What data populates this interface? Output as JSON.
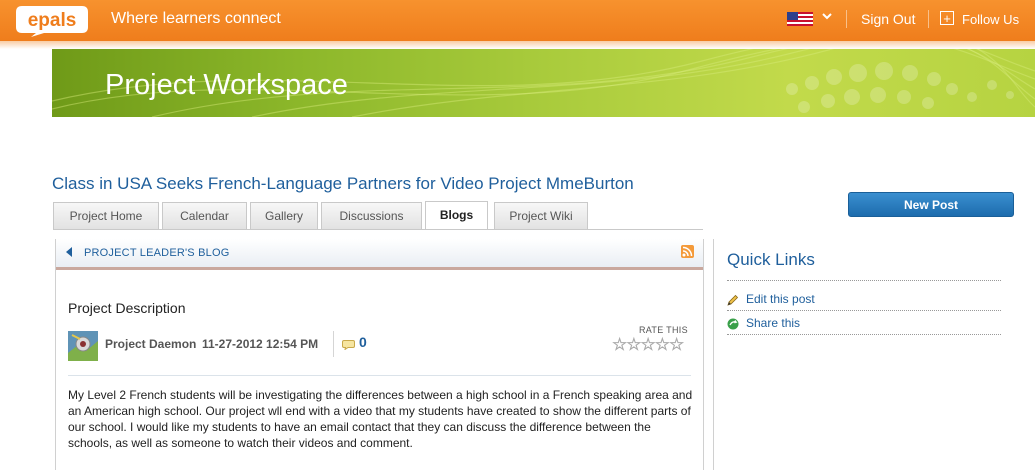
{
  "header": {
    "logo_text": "epals",
    "tagline": "Where learners connect",
    "sign_out": "Sign Out",
    "follow_us": "Follow Us",
    "follow_icon": "+"
  },
  "banner": {
    "title": "Project Workspace"
  },
  "project": {
    "title": "Class in USA Seeks French-Language Partners for Video Project MmeBurton"
  },
  "tabs": [
    {
      "label": "Project Home"
    },
    {
      "label": "Calendar"
    },
    {
      "label": "Gallery"
    },
    {
      "label": "Discussions"
    },
    {
      "label": "Blogs",
      "active": true
    },
    {
      "label": "Project Wiki"
    }
  ],
  "new_post_button": "New Post",
  "blog": {
    "header_label": "PROJECT LEADER'S BLOG",
    "post_title": "Project Description",
    "author": "Project Daemon",
    "date": "11-27-2012 12:54 PM",
    "comment_count": "0",
    "rate_label": "RATE THIS",
    "rating_stars": 0,
    "stars_max": 5,
    "body": "My Level 2 French students will be investigating the differences between a high school in a French speaking area and an American high school. Our project wll end with a video that my students have created to show the different parts of our school.  I would like my students to have an email contact that they can discuss the difference between the schools, as well as someone to watch their videos and comment."
  },
  "quick_links": {
    "title": "Quick Links",
    "items": [
      {
        "label": "Edit this post",
        "icon": "pencil-icon"
      },
      {
        "label": "Share this",
        "icon": "share-icon"
      }
    ]
  },
  "colors": {
    "orange": "#ef7d1c",
    "link_blue": "#1f5f9c",
    "green_banner": "#8cb72a",
    "button_blue": "#2a7fc2"
  }
}
